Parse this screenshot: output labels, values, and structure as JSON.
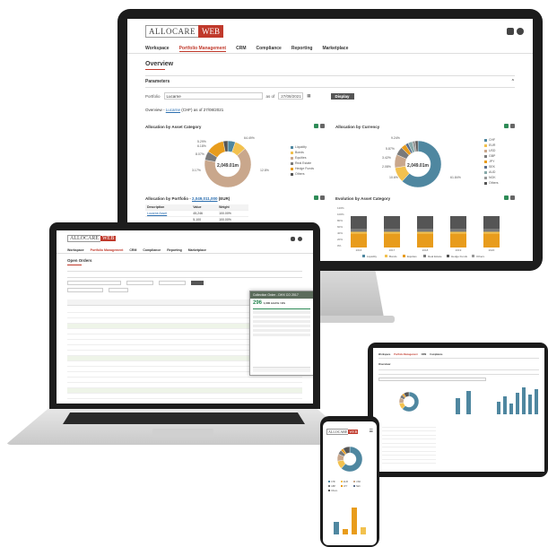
{
  "brand": {
    "name_left": "ALLOCARE",
    "name_right": "WEB",
    "accent": "#c0392b"
  },
  "menu": [
    "Workspace",
    "Portfolio Management",
    "CRM",
    "Compliance",
    "Reporting",
    "Marketplace"
  ],
  "monitor": {
    "page_title": "Overview",
    "parameters_label": "Parameters",
    "portfolio_label": "Portfolio",
    "portfolio_value": "Lucarne",
    "as_of_label": "as of",
    "as_of_value": "27/08/2021",
    "display_button": "Display",
    "overview_line_prefix": "Overview - ",
    "overview_line_link": "Lucarne",
    "overview_line_suffix": " (CHF) as of 27/08/2021",
    "alloc_asset_title": "Allocation by Asset Category",
    "alloc_asset_center": "2,049.01m",
    "alloc_asset_legend": [
      "Liquidity",
      "Bonds",
      "Equities",
      "Real Estate",
      "Hedge Funds",
      "Others"
    ],
    "alloc_asset_labels": [
      "5.29%",
      "8.07%",
      "6.18%",
      "64.49%",
      "12.8%",
      "3.17%"
    ],
    "alloc_ccy_title": "Allocation by Currency",
    "alloc_ccy_center": "2,049.01m",
    "alloc_ccy_legend": [
      "CHF",
      "EUR",
      "USD",
      "GBP",
      "JPY",
      "SEK",
      "AUD",
      "NOK",
      "Others"
    ],
    "alloc_ccy_labels": [
      "9.24%",
      "5.87%",
      "3.42%",
      "2.08%",
      "61.84%",
      "10.6%"
    ],
    "alloc_ptf_title_prefix": "Allocation by Portfolio - ",
    "alloc_ptf_title_link": "2,049,011,000",
    "alloc_ptf_title_suffix": " (EUR)",
    "alloc_ptf_headers": [
      "Description",
      "Value",
      "Weight"
    ],
    "alloc_ptf_rows": [
      [
        "Lucarne Asset",
        "45,246",
        "100.00%"
      ],
      [
        "",
        "5,100",
        "100.00%"
      ]
    ],
    "alloc_ptf_total": [
      "Total",
      "45,246",
      "100.00%"
    ],
    "evolution_title": "Evolution by Asset Category",
    "evolution_years": [
      "2016",
      "2017",
      "2018",
      "2019",
      "2020"
    ],
    "evolution_legend": [
      "Liquidity",
      "Bonds",
      "Equities",
      "Real Estate",
      "Hedge Funds",
      "Others"
    ],
    "evolution_yticks": [
      "120%",
      "100%",
      "80%",
      "60%",
      "40%",
      "20%",
      "0%"
    ]
  },
  "laptop": {
    "page_title": "Open Orders",
    "popup_title": "Collection Order - DHX CO 2017",
    "popup_value": "296",
    "popup_sub": "1,000 AAA% / 9%"
  },
  "phone": {
    "legend": [
      "CHF",
      "EUR",
      "USD",
      "GBP",
      "JPY",
      "SEK",
      "Others"
    ]
  },
  "colors": {
    "teal": "#4f87a0",
    "yellow": "#f2c14e",
    "tan": "#c9a78c",
    "grey": "#7a7a7a",
    "orange": "#e89c1c",
    "dark": "#555555",
    "blue": "#4f87a0"
  }
}
